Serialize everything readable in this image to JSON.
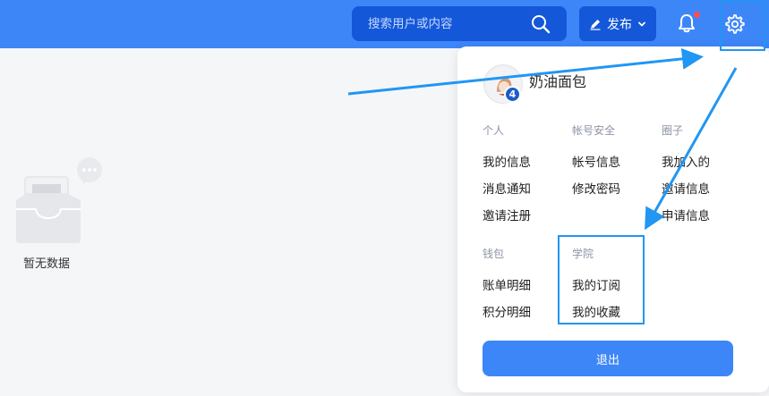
{
  "header": {
    "search_placeholder": "搜索用户或内容",
    "publish_label": "发布",
    "has_notification": true
  },
  "empty_state": {
    "text": "暂无数据"
  },
  "user_menu": {
    "username": "奶油面包",
    "avatar_badge": "4",
    "sections": [
      {
        "title": "个人",
        "items": [
          "我的信息",
          "消息通知",
          "邀请注册"
        ]
      },
      {
        "title": "帐号安全",
        "items": [
          "帐号信息",
          "修改密码"
        ]
      },
      {
        "title": "圈子",
        "items": [
          "我加入的",
          "邀请信息",
          "申请信息"
        ]
      },
      {
        "title": "钱包",
        "items": [
          "账单明细",
          "积分明细"
        ]
      },
      {
        "title": "学院",
        "items": [
          "我的订阅",
          "我的收藏"
        ]
      }
    ],
    "logout_label": "退出"
  },
  "colors": {
    "primary": "#3d86f8",
    "header_dark": "#1458d9",
    "annotation": "#2196f3"
  }
}
